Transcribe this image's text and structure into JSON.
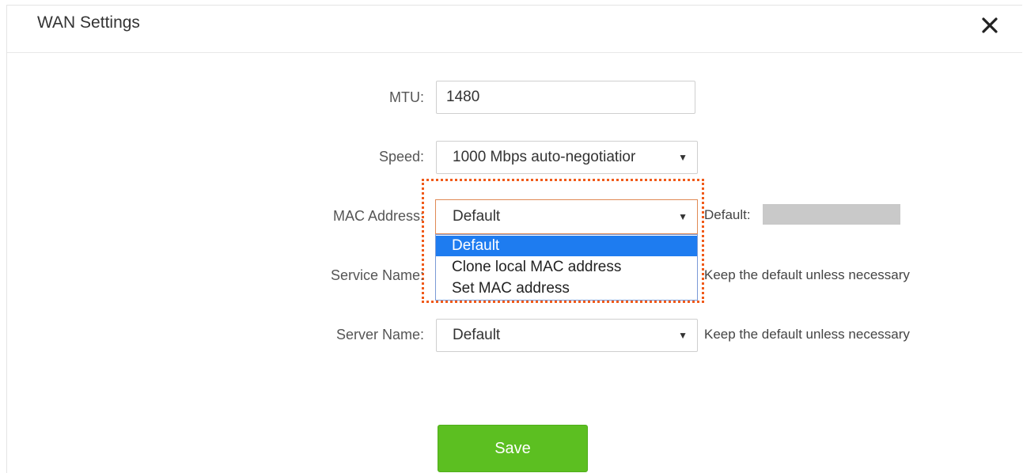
{
  "dialog": {
    "title": "WAN Settings",
    "close_icon": "close-icon"
  },
  "form": {
    "mtu": {
      "label": "MTU:",
      "value": "1480"
    },
    "speed": {
      "label": "Speed:",
      "value": "1000 Mbps auto-negotiatior"
    },
    "mac_address": {
      "label": "MAC Address:",
      "value": "Default",
      "options": [
        "Default",
        "Clone local MAC address",
        "Set MAC address"
      ],
      "selected_index": 0,
      "default_label": "Default:"
    },
    "service_name": {
      "label": "Service Name:",
      "hint": "Keep the default unless necessary"
    },
    "server_name": {
      "label": "Server Name:",
      "value": "Default",
      "hint": "Keep the default unless necessary"
    }
  },
  "actions": {
    "save_label": "Save"
  },
  "colors": {
    "save_button": "#5cbf21",
    "highlight_border": "#f05a19",
    "selected_option": "#1e7cf0"
  }
}
